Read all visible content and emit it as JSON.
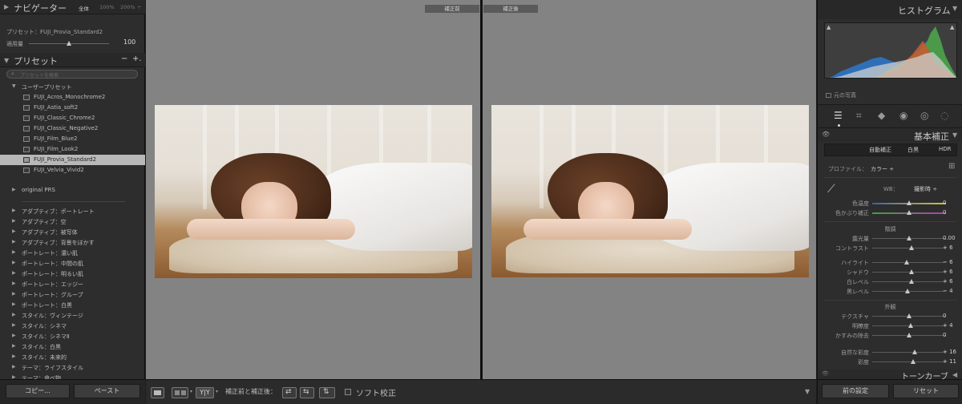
{
  "navigator": {
    "title": "ナビゲーター",
    "zoom": [
      "全体",
      "100%",
      "200%"
    ],
    "preset_label": "プリセット：FUJI_Provia_Standard2",
    "amount_label": "適用量",
    "amount_value": "100",
    "amount_fraction": 0.5
  },
  "presets": {
    "title": "プリセット",
    "minus": "−",
    "plus": "+.",
    "search_placeholder": "プリセットを検索",
    "user_group": "ユーザープリセット",
    "user_items": [
      "FUJI_Acros_Monochrome2",
      "FUJI_Astia_soft2",
      "FUJI_Classic_Chrome2",
      "FUJI_Classic_Negative2",
      "FUJI_Film_Blue2",
      "FUJI_Film_Look2",
      "FUJI_Provia_Standard2",
      "FUJI_Velvia_Vivid2"
    ],
    "selected_index": 6,
    "original_group": "original PRS",
    "groups": [
      "アダプティブ：ポートレート",
      "アダプティブ：空",
      "アダプティブ：被写体",
      "アダプティブ：背景をぼかす",
      "ポートレート：濃い肌",
      "ポートレート：中間の肌",
      "ポートレート：明るい肌",
      "ポートレート：エッジー",
      "ポートレート：グループ",
      "ポートレート：白黒",
      "スタイル：ヴィンテージ",
      "スタイル：シネマ",
      "スタイル：シネマⅡ",
      "スタイル：白黒",
      "スタイル：未来的",
      "テーマ：ライフスタイル",
      "テーマ：食べ物"
    ],
    "copy_button": "コピー...",
    "paste_button": "ペースト"
  },
  "view": {
    "before_label": "補正前",
    "after_label": "補正後"
  },
  "toolbar": {
    "yy_label": "Y|Y",
    "compare_label": "補正前と補正後：",
    "soft_proof_label": "ソフト校正"
  },
  "histogram": {
    "title": "ヒストグラム",
    "original_photo_label": "元の写真"
  },
  "basic": {
    "title": "基本補正",
    "auto_button": "自動補正",
    "bw_button": "白黒",
    "hdr_button": "HDR",
    "profile_label": "プロファイル：",
    "profile_value": "カラー ÷",
    "wb_label": "WB：",
    "wb_value": "撮影時 ÷",
    "sliders_wb": [
      {
        "label": "色温度",
        "value": "0",
        "pos": 0.5
      },
      {
        "label": "色かぶり補正",
        "value": "0",
        "pos": 0.5
      }
    ],
    "tone_header": "階調",
    "sliders_tone": [
      {
        "label": "露光量",
        "value": "0.00",
        "pos": 0.5
      },
      {
        "label": "コントラスト",
        "value": "+ 6",
        "pos": 0.53
      }
    ],
    "sliders_tone2": [
      {
        "label": "ハイライト",
        "value": "− 6",
        "pos": 0.47
      },
      {
        "label": "シャドウ",
        "value": "+ 6",
        "pos": 0.53
      },
      {
        "label": "白レベル",
        "value": "+ 6",
        "pos": 0.53
      },
      {
        "label": "黒レベル",
        "value": "− 4",
        "pos": 0.48
      }
    ],
    "presence_header": "外観",
    "sliders_presence": [
      {
        "label": "テクスチャ",
        "value": "0",
        "pos": 0.5
      },
      {
        "label": "明瞭度",
        "value": "+ 4",
        "pos": 0.52
      },
      {
        "label": "かすみの除去",
        "value": "0",
        "pos": 0.5
      }
    ],
    "sliders_saturation": [
      {
        "label": "自然な彩度",
        "value": "+ 16",
        "pos": 0.58
      },
      {
        "label": "彩度",
        "value": "+ 11",
        "pos": 0.55
      }
    ]
  },
  "tone_curve": {
    "title": "トーンカーブ"
  },
  "bottom_right": {
    "previous_button": "前の設定",
    "reset_button": "リセット"
  }
}
